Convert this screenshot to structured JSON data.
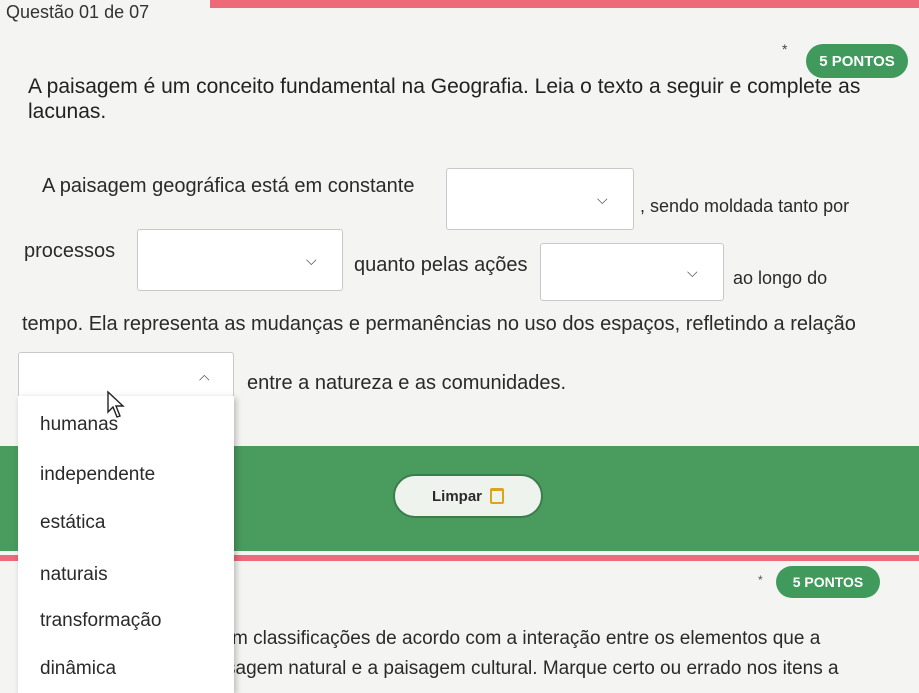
{
  "header": {
    "question_counter": "Questão 01 de 07"
  },
  "question1": {
    "required_marker": "*",
    "points": "5 PONTOS",
    "intro": "A paisagem é um conceito fundamental na Geografia. Leia o texto a seguir e complete as lacunas.",
    "line1_a": "A paisagem geográfica está em constante",
    "line1_b": ", sendo moldada tanto por",
    "line2_a": "processos",
    "line2_b": "quanto pelas ações",
    "line2_c": "ao longo do",
    "line3": "tempo. Ela representa as mudanças e permanências no uso dos espaços, refletindo a relação",
    "line4": "entre a natureza e as comunidades."
  },
  "dropdown": {
    "options": [
      "humanas",
      "independente",
      "estática",
      "naturais",
      "transformação",
      "dinâmica"
    ]
  },
  "actions": {
    "clear_label": "Limpar"
  },
  "question2": {
    "required_marker": "*",
    "points": "5 PONTOS",
    "text_line1": "m classificações de acordo com a interação entre os elementos que a",
    "text_line2": "sagem natural e a paisagem cultural. Marque certo ou errado nos itens a"
  },
  "colors": {
    "accent_green": "#3f9a5b",
    "band_green": "#4a9b5e",
    "accent_red": "#ef6a78"
  },
  "icons": {
    "select_closed": "chevron-down-icon",
    "select_open": "chevron-up-icon",
    "clear": "trash-icon",
    "pointer": "mouse-cursor-icon"
  }
}
